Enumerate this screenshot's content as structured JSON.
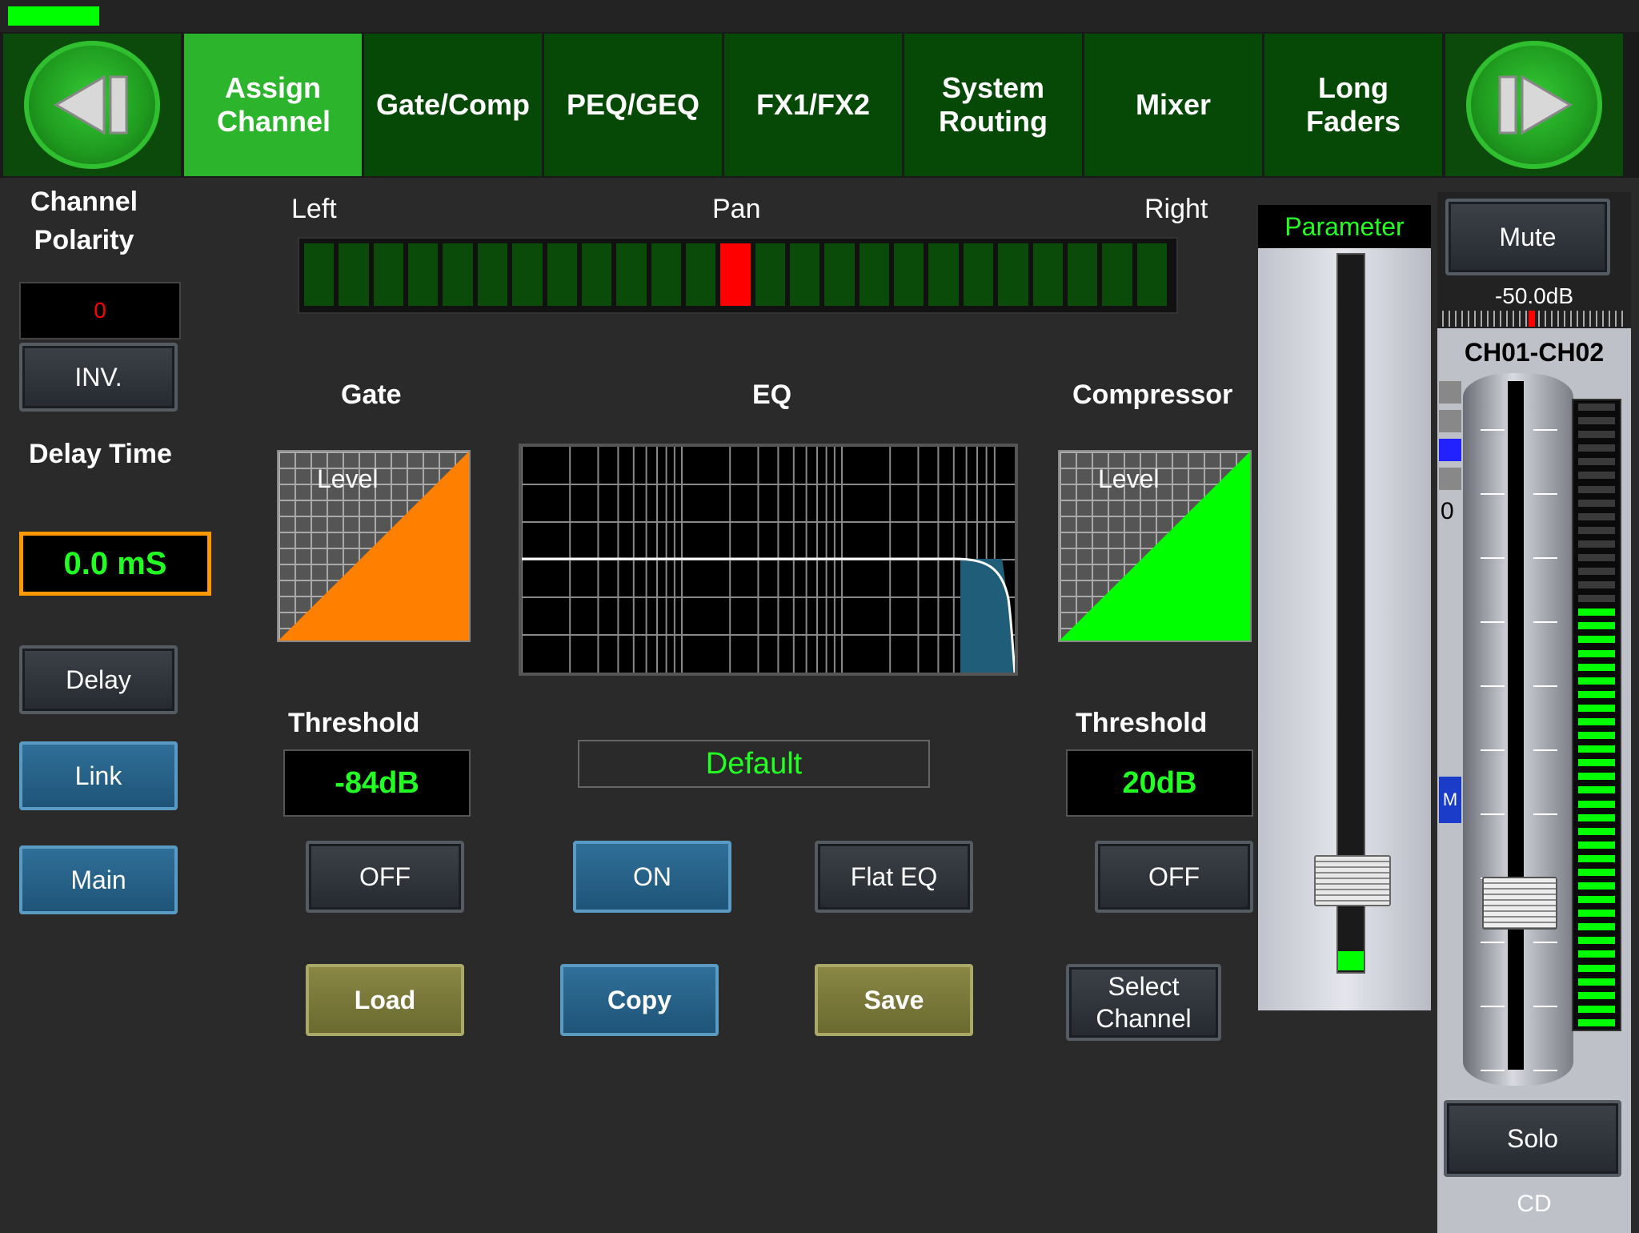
{
  "tabs": [
    {
      "label": "Assign Channel",
      "active": true
    },
    {
      "label": "Gate/Comp",
      "active": false
    },
    {
      "label": "PEQ/GEQ",
      "active": false
    },
    {
      "label": "FX1/FX2",
      "active": false
    },
    {
      "label": "System Routing",
      "active": false
    },
    {
      "label": "Mixer",
      "active": false
    },
    {
      "label": "Long Faders",
      "active": false
    }
  ],
  "left": {
    "polarity_label": "Channel Polarity",
    "polarity_value": "0",
    "inv_label": "INV.",
    "delay_time_label": "Delay Time",
    "delay_value": "0.0 mS",
    "delay_button": "Delay",
    "link_button": "Link",
    "main_button": "Main"
  },
  "pan": {
    "left_label": "Left",
    "title": "Pan",
    "right_label": "Right",
    "segments": 25,
    "active_segment": 12
  },
  "gate": {
    "title": "Gate",
    "graph_label": "Level",
    "threshold_label": "Threshold",
    "threshold_value": "-84dB",
    "toggle": "OFF",
    "color": "#ff8000"
  },
  "eq": {
    "title": "EQ",
    "preset": "Default",
    "toggle": "ON",
    "flat_button": "Flat EQ"
  },
  "compressor": {
    "title": "Compressor",
    "graph_label": "Level",
    "threshold_label": "Threshold",
    "threshold_value": "20dB",
    "toggle": "OFF",
    "color": "#00ff00"
  },
  "actions": {
    "load": "Load",
    "copy": "Copy",
    "save": "Save",
    "select_channel": "Select Channel"
  },
  "parameter": {
    "label": "Parameter",
    "level": 0.1
  },
  "channel_strip": {
    "mute": "Mute",
    "level_db": "-50.0dB",
    "name": "CH01-CH02",
    "zero_label": "0",
    "m_marker": "M",
    "solo": "Solo",
    "footer": "CD",
    "fader_level": 0.22,
    "meter_level": 0.68
  },
  "colors": {
    "accent_green": "#00ff00",
    "tab_active": "#2cb52c",
    "tab_inactive": "#064806",
    "pan_active": "#ff0000",
    "delay_border": "#ff9900"
  }
}
